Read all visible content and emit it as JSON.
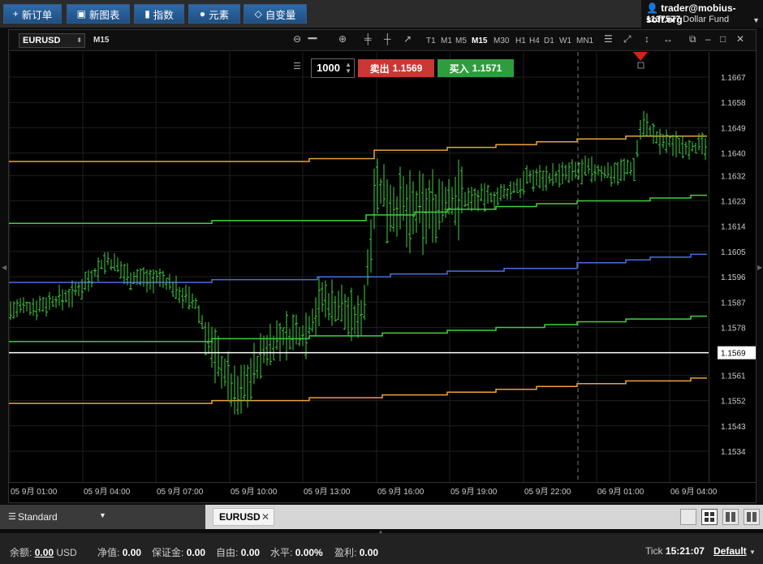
{
  "toolbar": {
    "new_order": "新订单",
    "new_chart": "新图表",
    "indicators": "指数",
    "elements": "元素",
    "custom": "自变量"
  },
  "account": {
    "user": "trader@mobius-soft.org",
    "number": "1137577",
    "fund": "Dollar Fund"
  },
  "chart": {
    "symbol": "EURUSD",
    "timeframe": "M15",
    "timeframes": [
      "T1",
      "M1",
      "M5",
      "M15",
      "M30",
      "H1",
      "H4",
      "D1",
      "W1",
      "MN1"
    ],
    "active_timeframe": "M15",
    "order": {
      "quantity": "1000",
      "sell_label": "卖出",
      "sell_price": "1.1569",
      "buy_label": "买入",
      "buy_price": "1.1571"
    },
    "current_price": "1.1569",
    "price_ticks": [
      "1.1667",
      "1.1658",
      "1.1649",
      "1.1640",
      "1.1632",
      "1.1623",
      "1.1614",
      "1.1605",
      "1.1596",
      "1.1587",
      "1.1578",
      "1.1561",
      "1.1552",
      "1.1543",
      "1.1534"
    ],
    "time_ticks": [
      "05 9月 01:00",
      "05 9月 04:00",
      "05 9月 07:00",
      "05 9月 10:00",
      "05 9月 13:00",
      "05 9月 16:00",
      "05 9月 19:00",
      "05 9月 22:00",
      "06 9月 01:00",
      "06 9月 04:00"
    ],
    "colors": {
      "bars": "#3fcf3f",
      "upper_outer": "#e8a33a",
      "inner_band": "#3fcf3f",
      "middle": "#4a6fe0",
      "current_line": "#ffffff"
    }
  },
  "tabs": {
    "workspace": "Standard",
    "chart_tab": "EURUSD"
  },
  "status": {
    "balance_label": "余额:",
    "balance_value": "0.00",
    "balance_currency": "USD",
    "equity_label": "净值:",
    "equity_value": "0.00",
    "margin_label": "保证金:",
    "margin_value": "0.00",
    "free_label": "自由:",
    "free_value": "0.00",
    "level_label": "水平:",
    "level_value": "0.00%",
    "profit_label": "盈利:",
    "profit_value": "0.00",
    "tick_label": "Tick",
    "time": "15:21:07",
    "profile": "Default"
  }
}
